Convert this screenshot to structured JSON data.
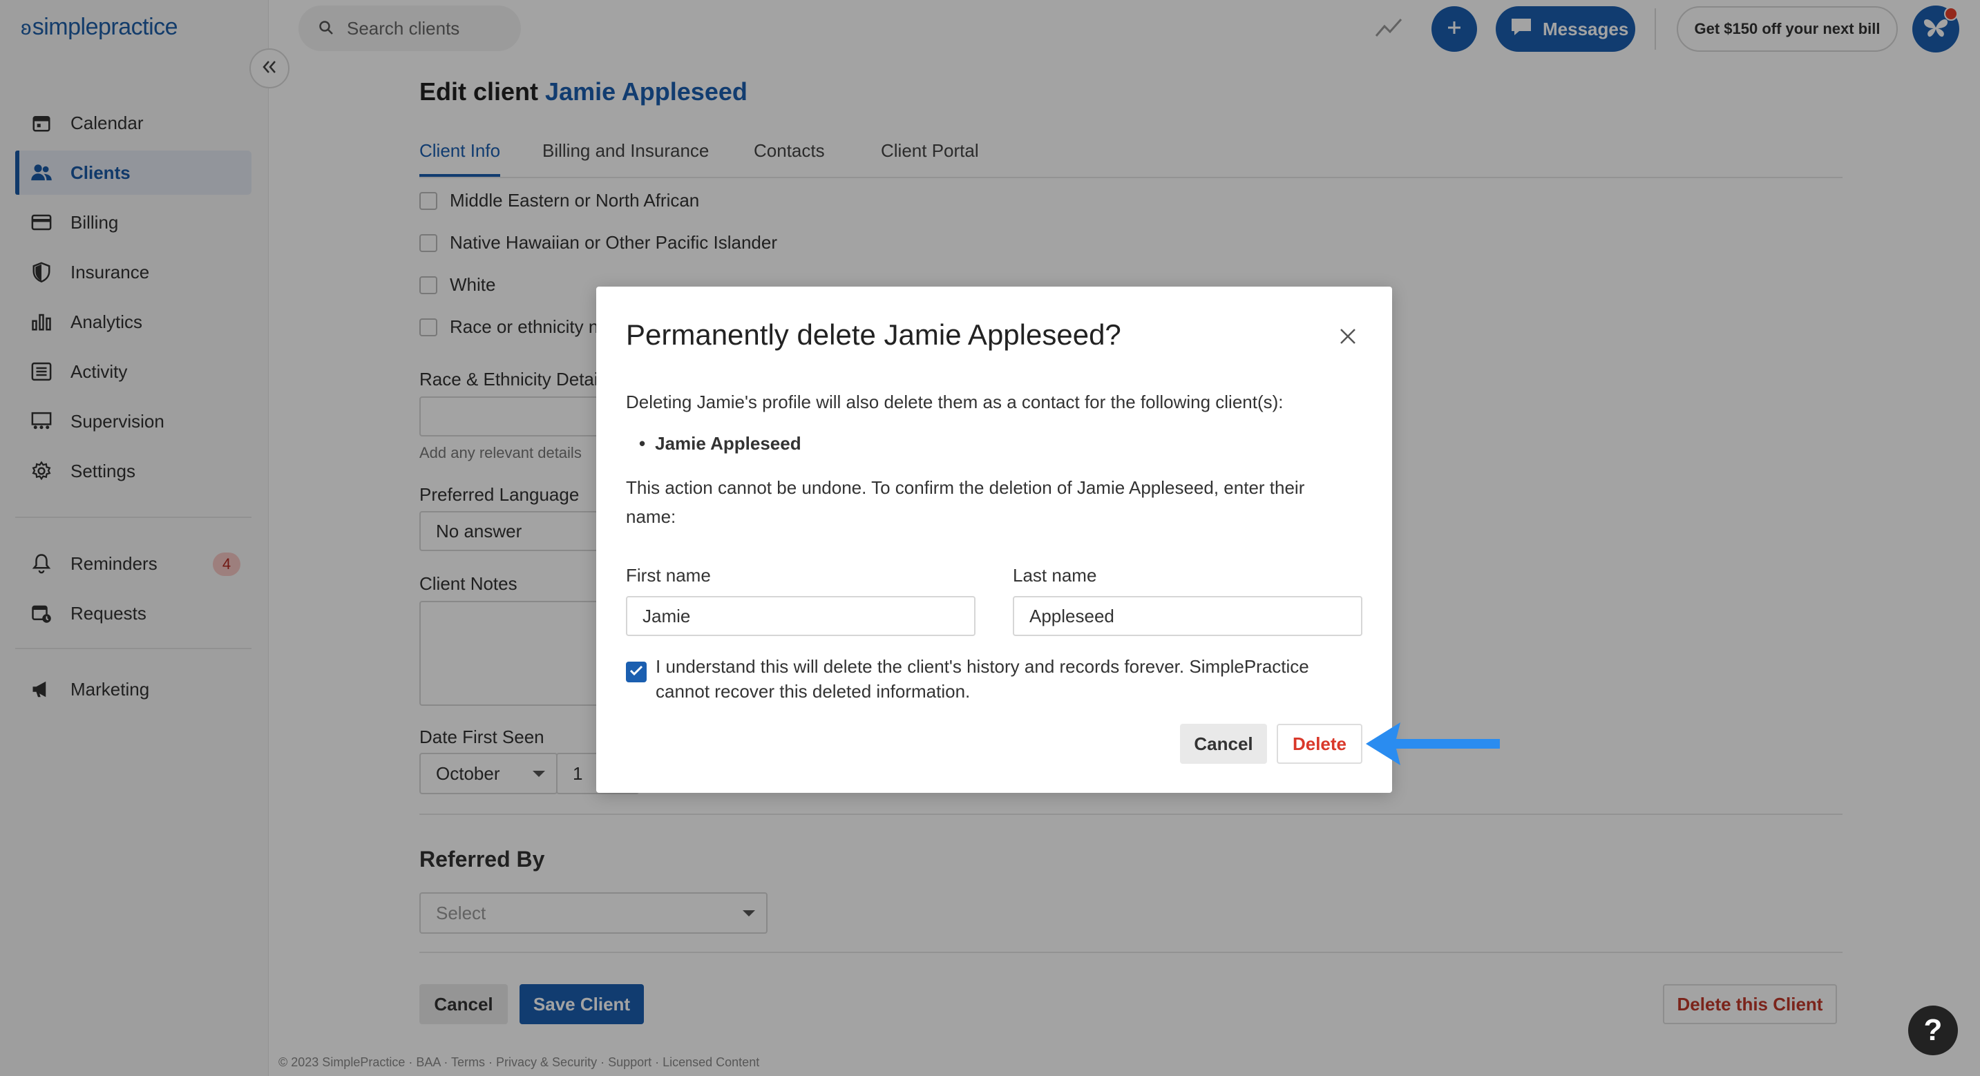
{
  "app": {
    "logo_text": "simplepractice"
  },
  "sidebar": {
    "items": [
      {
        "label": "Calendar",
        "icon": "calendar-icon"
      },
      {
        "label": "Clients",
        "icon": "people-icon"
      },
      {
        "label": "Billing",
        "icon": "credit-card-icon"
      },
      {
        "label": "Insurance",
        "icon": "shield-icon"
      },
      {
        "label": "Analytics",
        "icon": "bar-chart-icon"
      },
      {
        "label": "Activity",
        "icon": "list-icon"
      },
      {
        "label": "Supervision",
        "icon": "supervision-icon"
      },
      {
        "label": "Settings",
        "icon": "gear-icon"
      }
    ],
    "secondary": [
      {
        "label": "Reminders",
        "icon": "bell-icon",
        "badge": "4"
      },
      {
        "label": "Requests",
        "icon": "calendar-request-icon"
      }
    ],
    "tertiary": [
      {
        "label": "Marketing",
        "icon": "megaphone-icon"
      }
    ],
    "active": "Clients"
  },
  "topbar": {
    "search_placeholder": "Search clients",
    "messages_label": "Messages",
    "offer_label": "Get $150 off your next bill"
  },
  "page": {
    "title_prefix": "Edit client",
    "client_name": "Jamie Appleseed",
    "tabs": [
      "Client Info",
      "Billing and Insurance",
      "Contacts",
      "Client Portal"
    ],
    "active_tab": "Client Info",
    "race_options": [
      "Middle Eastern or North African",
      "Native Hawaiian or Other Pacific Islander",
      "White",
      "Race or ethnicity n"
    ],
    "race_details_label": "Race & Ethnicity Detai",
    "race_details_help": "Add any relevant details",
    "preferred_language_label": "Preferred Language",
    "preferred_language_value": "No answer",
    "client_notes_label": "Client Notes",
    "date_first_seen_label": "Date First Seen",
    "date_first_seen_month": "October",
    "date_first_seen_day": "1",
    "referred_by_title": "Referred By",
    "referred_by_placeholder": "Select",
    "cancel_label": "Cancel",
    "save_label": "Save Client",
    "delete_client_label": "Delete this Client",
    "footer_text": "© 2023 SimplePractice · BAA · Terms · Privacy & Security · Support · Licensed Content"
  },
  "modal": {
    "title": "Permanently delete Jamie Appleseed?",
    "intro": "Deleting Jamie's profile will also delete them as a contact for the following client(s):",
    "related_clients": [
      "Jamie Appleseed"
    ],
    "confirm_text": "This action cannot be undone. To confirm the deletion of Jamie Appleseed, enter their name:",
    "first_name_label": "First name",
    "first_name_value": "Jamie",
    "last_name_label": "Last name",
    "last_name_value": "Appleseed",
    "acknowledge_text": "I understand this will delete the client's history and records forever. SimplePractice cannot recover this deleted information.",
    "acknowledge_checked": true,
    "cancel_label": "Cancel",
    "delete_label": "Delete"
  },
  "colors": {
    "brand_blue": "#1b5fb0",
    "danger_red": "#c0392b",
    "annotation_arrow": "#2a8cf0"
  }
}
